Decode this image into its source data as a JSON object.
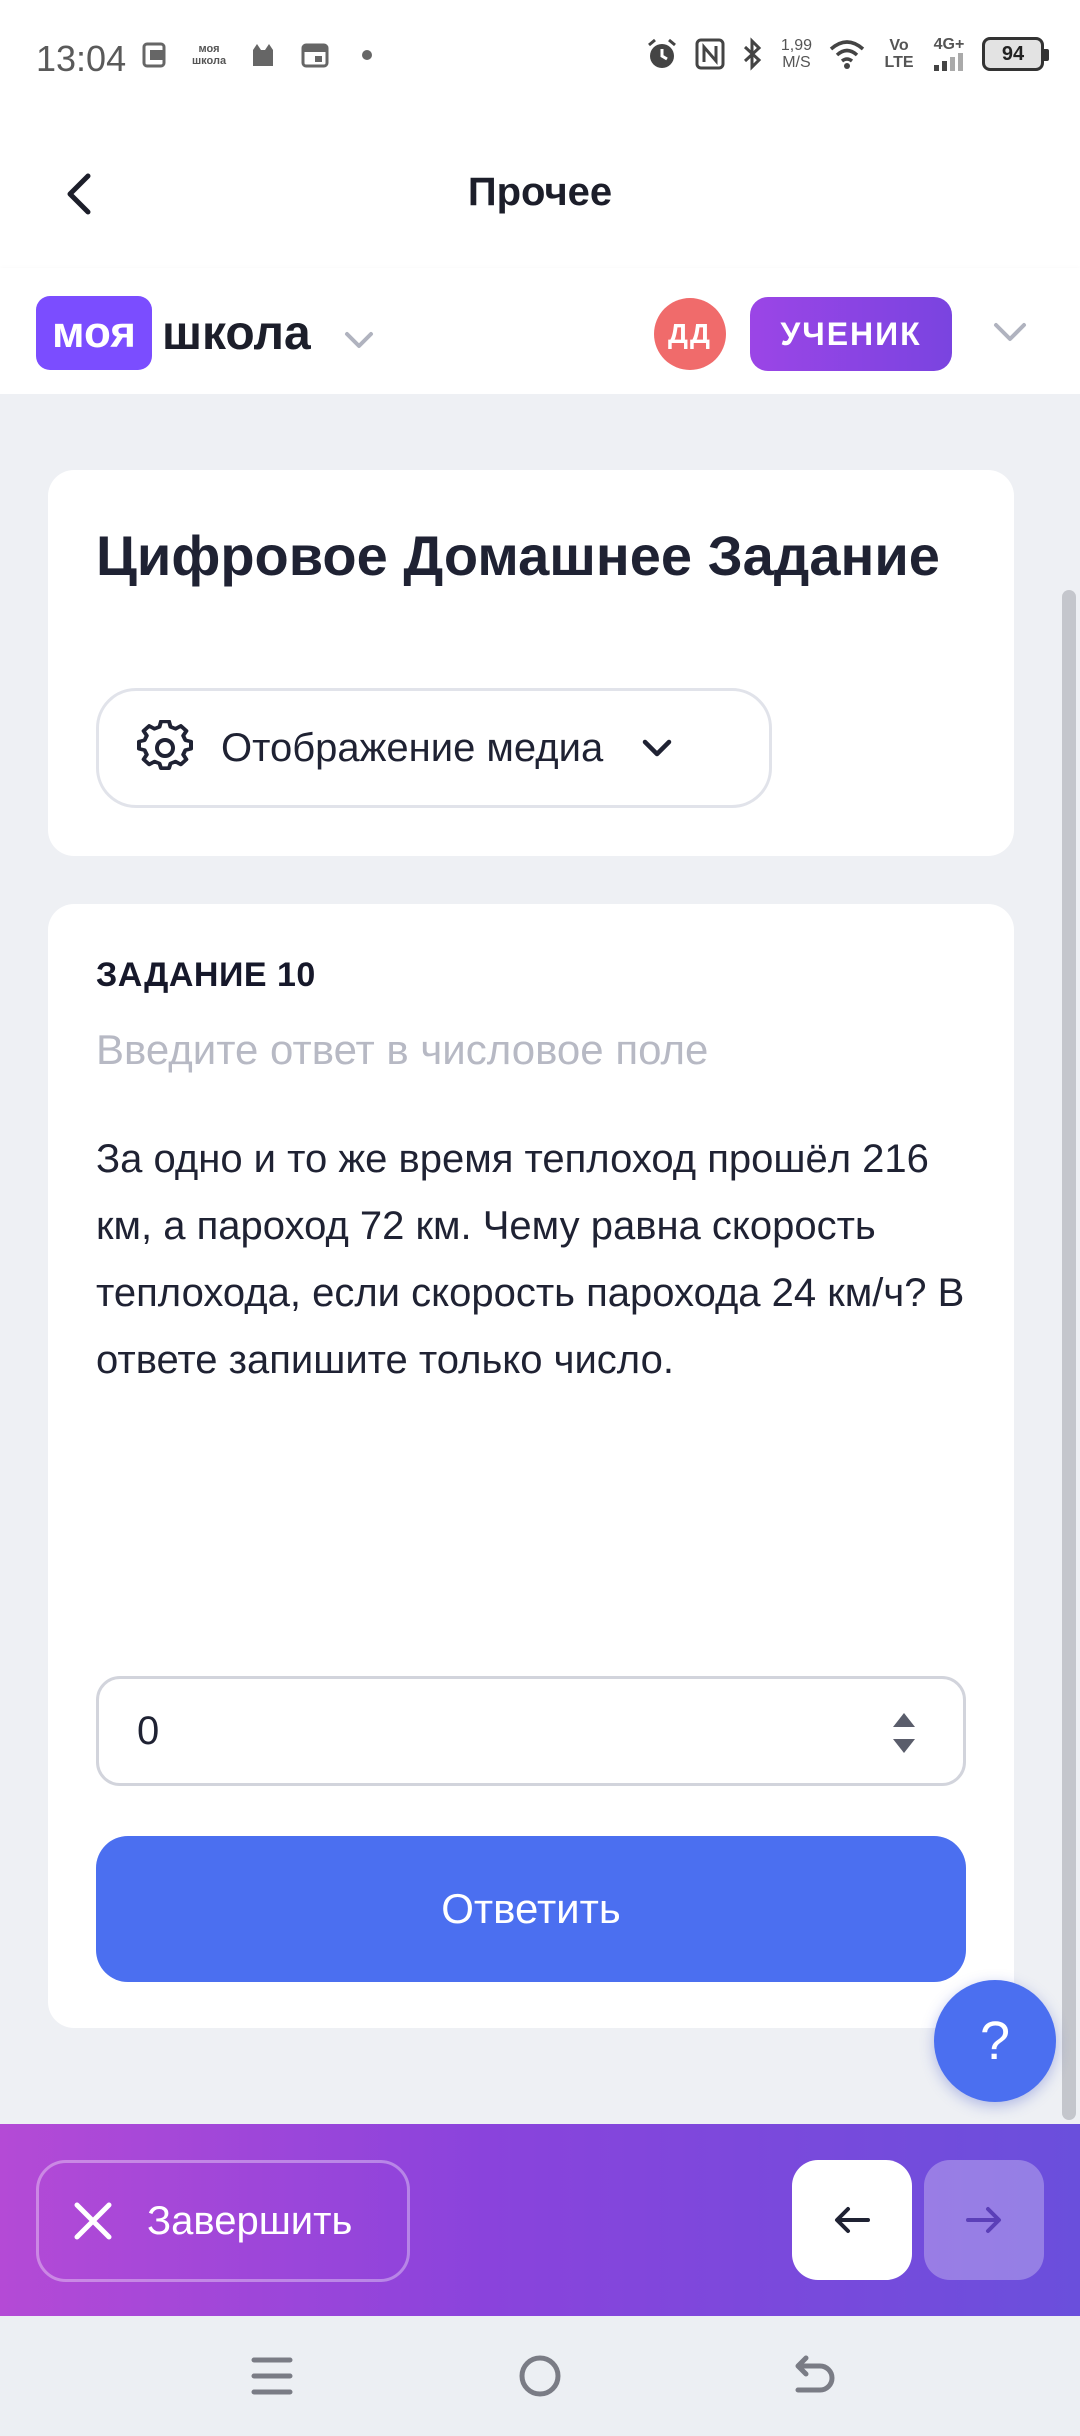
{
  "status_bar": {
    "time": "13:04",
    "left_icons": [
      "pdf-app-icon",
      "moya-shkola-app-icon",
      "cat-app-icon",
      "calendar-app-icon",
      "dot-icon"
    ],
    "moya_shkola_mini": "моя школа",
    "speed_value": "1,99",
    "speed_unit": "M/S",
    "volte": "Vo LTE",
    "network": "4G+",
    "battery": "94"
  },
  "topbar": {
    "title": "Прочее"
  },
  "header": {
    "logo_left": "моя",
    "logo_right": "школа",
    "avatar_initials": "ДД",
    "role": "УЧЕНИК"
  },
  "title_card": {
    "title": "Цифровое Домашнее Задание",
    "media_button_label": "Отображение медиа"
  },
  "task_card": {
    "task_number": "ЗАДАНИЕ 10",
    "hint": "Введите ответ в числовое поле",
    "text": "За одно и то же время теплоход прошёл 216 км, а пароход 72 км. Чему равна скорость теплохода, если скорость парохода 24 км/ч? В ответе запишите только число.",
    "answer_value": "0",
    "submit_label": "Ответить"
  },
  "help_button": {
    "label": "?"
  },
  "action_bar": {
    "finish_label": "Завершить"
  },
  "colors": {
    "brand_purple": "#7b4dff",
    "primary_blue": "#4b6ff0",
    "avatar_red": "#f06b6b",
    "gradient_start": "#b44ad6",
    "gradient_end": "#6a4fdc"
  }
}
